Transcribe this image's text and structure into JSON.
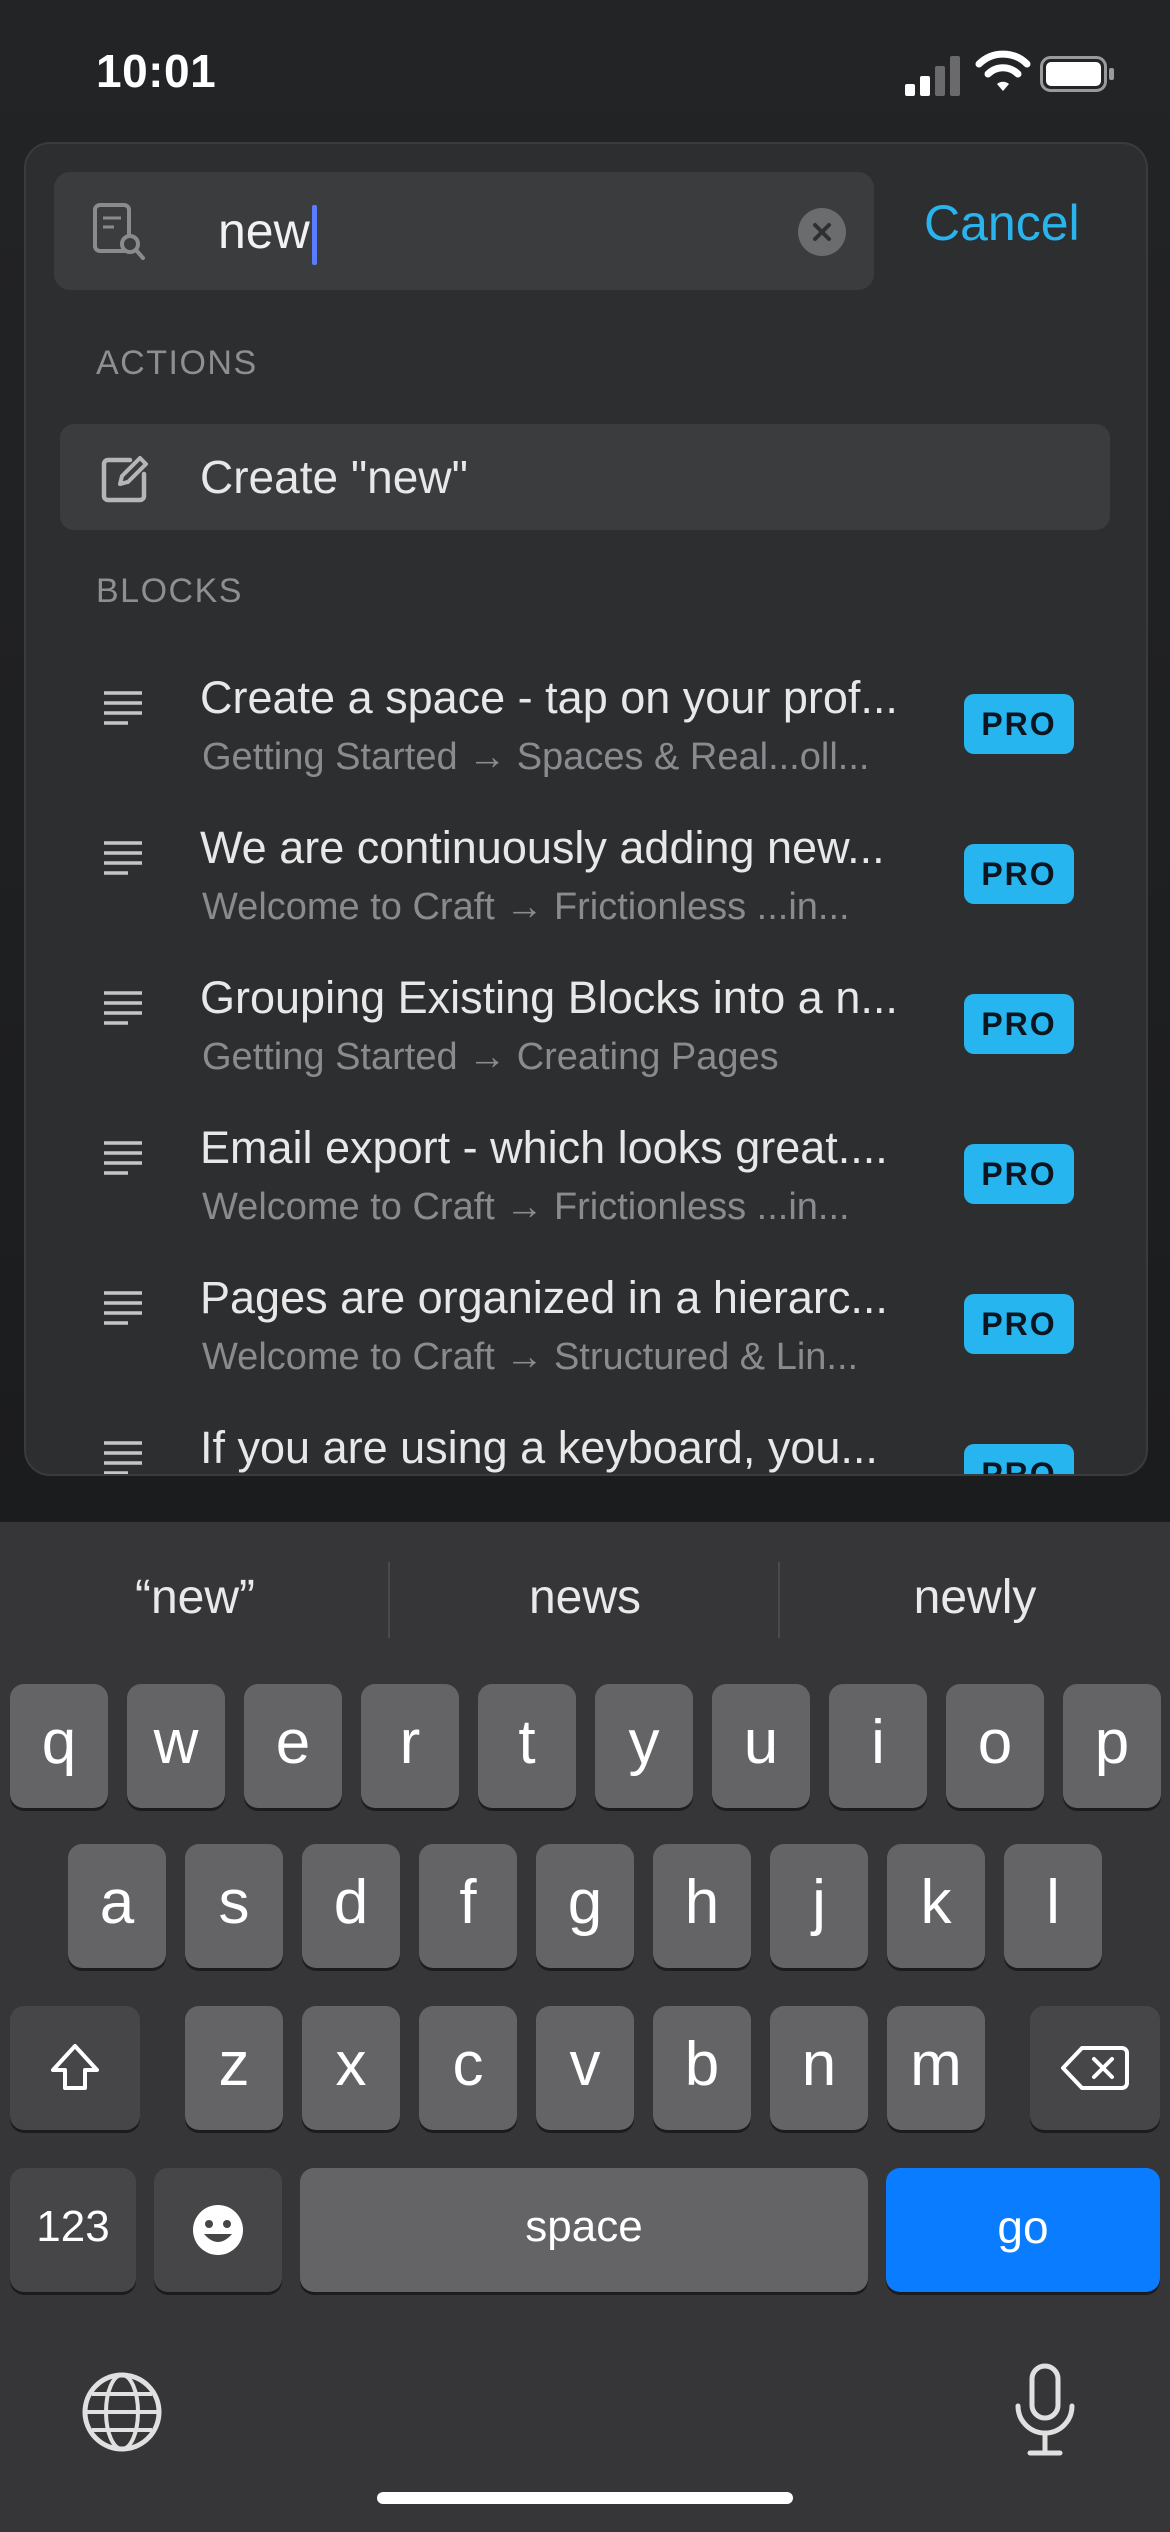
{
  "status_bar": {
    "time": "10:01"
  },
  "search": {
    "query": "new",
    "cancel_label": "Cancel"
  },
  "sections": {
    "actions_title": "ACTIONS",
    "blocks_title": "BLOCKS"
  },
  "action": {
    "label": "Create \"new\""
  },
  "results": [
    {
      "title": "Create a space - tap on your prof...",
      "path": "Getting Started → Spaces & Real...oll...",
      "badge": "PRO"
    },
    {
      "title": "We are continuously adding new...",
      "path": "Welcome to Craft → Frictionless ...in...",
      "badge": "PRO"
    },
    {
      "title": "Grouping Existing Blocks into a n...",
      "path": "Getting Started → Creating Pages",
      "badge": "PRO"
    },
    {
      "title": "Email export - which looks great....",
      "path": "Welcome to Craft → Frictionless ...in...",
      "badge": "PRO"
    },
    {
      "title": "Pages are organized in a hierarc...",
      "path": "Welcome to Craft → Structured & Lin...",
      "badge": "PRO"
    },
    {
      "title": "If you are using a keyboard, you...",
      "path": "",
      "badge": "PRO"
    }
  ],
  "keyboard": {
    "suggestions": [
      "“new”",
      "news",
      "newly"
    ],
    "row1": [
      "q",
      "w",
      "e",
      "r",
      "t",
      "y",
      "u",
      "i",
      "o",
      "p"
    ],
    "row2": [
      "a",
      "s",
      "d",
      "f",
      "g",
      "h",
      "j",
      "k",
      "l"
    ],
    "row3": [
      "z",
      "x",
      "c",
      "v",
      "b",
      "n",
      "m"
    ],
    "numbers_label": "123",
    "space_label": "space",
    "go_label": "go"
  },
  "colors": {
    "accent": "#2ab4ee",
    "pro_badge": "#27b5ef",
    "go_key": "#0a7cff",
    "caret": "#5b7cff"
  },
  "icons": [
    "document-search-icon",
    "clear-icon",
    "edit-icon",
    "text-lines-icon",
    "shift-icon",
    "backspace-icon",
    "emoji-icon",
    "globe-icon",
    "microphone-icon"
  ]
}
